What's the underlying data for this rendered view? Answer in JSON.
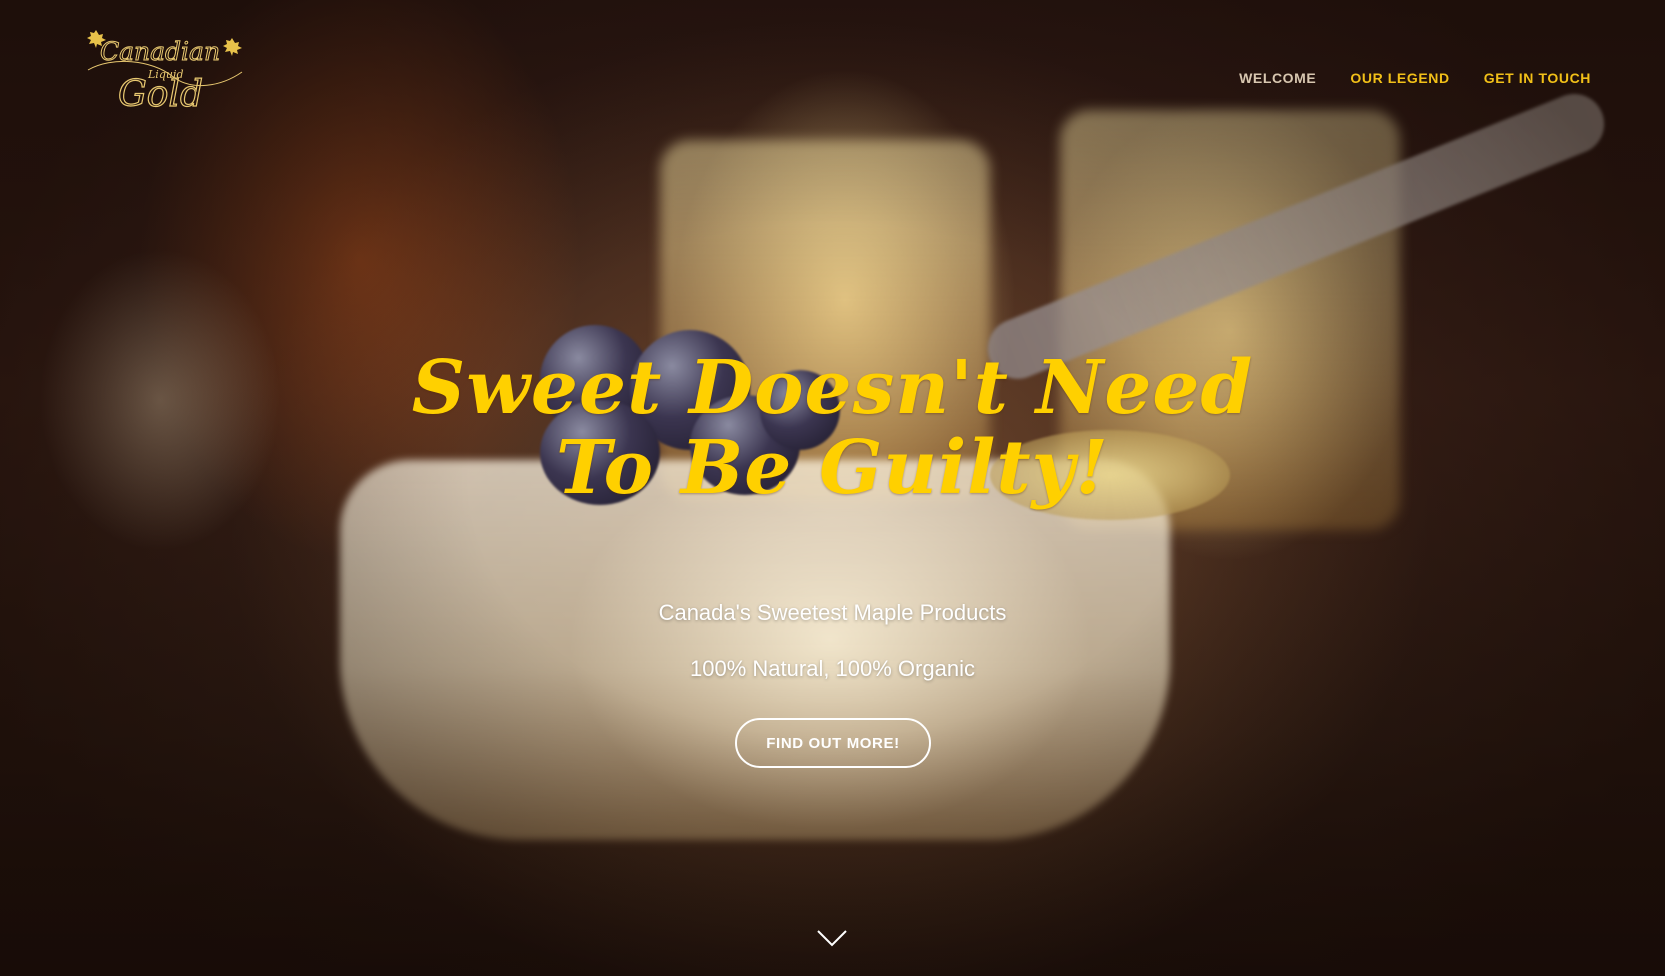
{
  "logo": {
    "text_line1": "Canadian",
    "text_line2": "Liquid",
    "text_line3": "Gold"
  },
  "nav": {
    "items": [
      {
        "label": "WELCOME",
        "active": true
      },
      {
        "label": "OUR LEGEND",
        "active": false
      },
      {
        "label": "GET IN TOUCH",
        "active": false
      }
    ]
  },
  "hero": {
    "headline": "Sweet Doesn't Need To Be Guilty!",
    "subline_1": "Canada's Sweetest Maple Products",
    "subline_2": "100% Natural, 100% Organic",
    "cta_label": "FIND OUT MORE!",
    "scroll_icon": "chevron-down-icon"
  },
  "colors": {
    "accent": "#ffd000",
    "nav_text": "#f2c018",
    "nav_active": "#d8c7b0",
    "button_border": "#ffffff"
  }
}
